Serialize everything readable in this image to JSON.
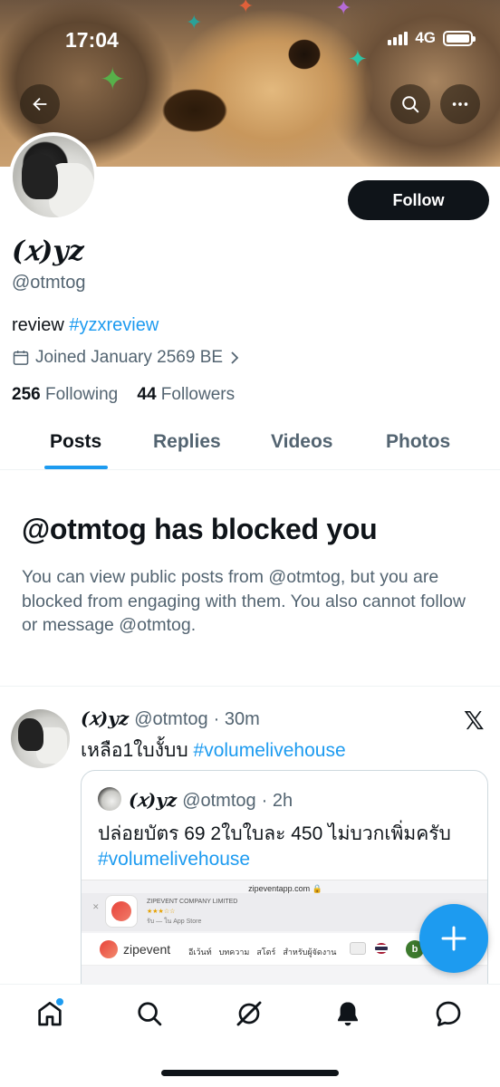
{
  "status_bar": {
    "time": "17:04",
    "network": "4G"
  },
  "profile": {
    "display_name": "(𝑥)yz",
    "handle": "@otmtog",
    "bio_text": "review ",
    "bio_hashtag": "#yzxreview",
    "joined": "Joined January 2569 BE",
    "following_count": "256",
    "following_label": " Following",
    "followers_count": "44",
    "followers_label": " Followers",
    "follow_label": "Follow"
  },
  "tabs": [
    {
      "label": "Posts",
      "active": true
    },
    {
      "label": "Replies",
      "active": false
    },
    {
      "label": "Videos",
      "active": false
    },
    {
      "label": "Photos",
      "active": false
    }
  ],
  "blocked": {
    "title": "@otmtog has blocked you",
    "description": "You can view public posts from @otmtog, but you are blocked from engaging with them. You also cannot follow or message @otmtog."
  },
  "post": {
    "author_name": "(𝑥)yz",
    "author_handle": "@otmtog",
    "time": "· 30m",
    "text": "เหลือ1ใบงั้บบ ",
    "hashtag": "#volumelivehouse",
    "quote": {
      "author_name": "(𝑥)yz",
      "author_handle": "@otmtog",
      "time": "· 2h",
      "text": "ปล่อยบัตร 69 2ใบใบละ 450 ไม่บวกเพิ่มครับ",
      "hashtag": "#volumelivehouse",
      "image": {
        "url": "zipeventapp.com 🔒",
        "company": "ZIPEVENT COMPANY LIMITED",
        "stars": "★★★☆☆",
        "store": "รับ — ใน App Store",
        "logo_text": "zipevent",
        "nav_links": [
          "อีเว้นท์",
          "บทความ",
          "สโตร์",
          "สำหรับผู้จัดงาน"
        ],
        "profile_initial": "b"
      }
    }
  },
  "bottom_nav": [
    "home-icon",
    "search-icon",
    "grok-icon",
    "notifications-icon",
    "messages-icon"
  ],
  "colors": {
    "accent": "#1d9bf0",
    "text": "#0f1419",
    "secondary": "#536471"
  }
}
